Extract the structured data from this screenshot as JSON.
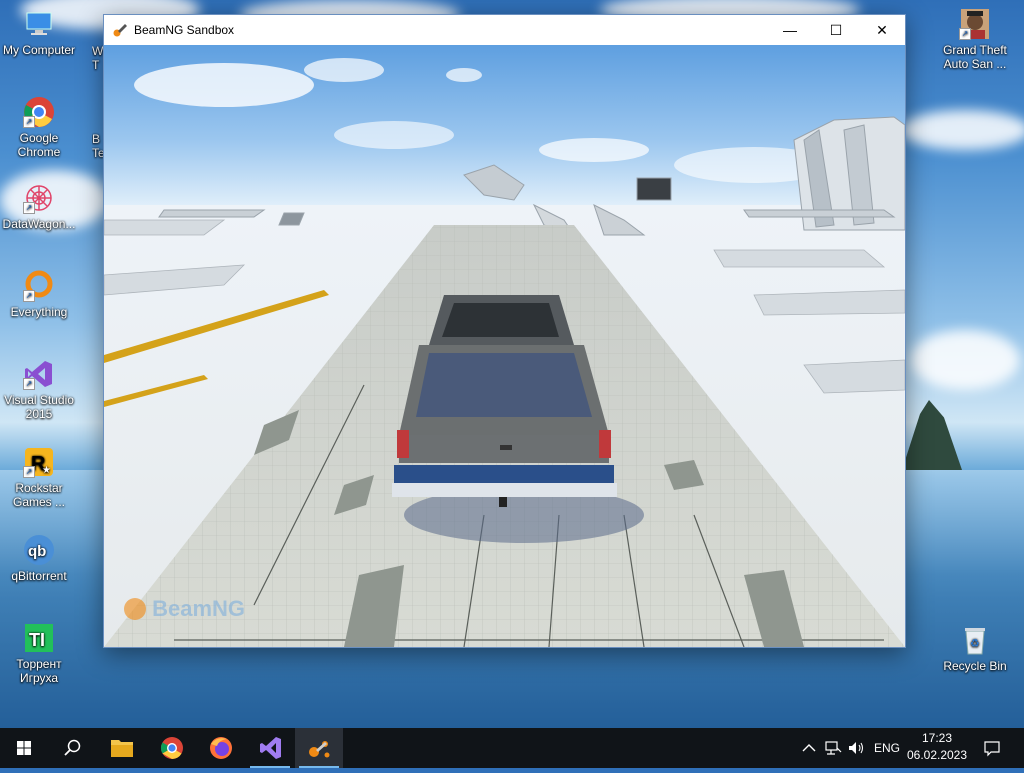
{
  "window": {
    "title": "BeamNG Sandbox",
    "minimize_glyph": "—",
    "maximize_glyph": "☐",
    "close_glyph": "✕",
    "watermark": "BeamNG"
  },
  "desktop_icons": [
    {
      "label": "My Computer",
      "icon": "computer-icon"
    },
    {
      "label": "Google Chrome",
      "icon": "chrome-icon"
    },
    {
      "label": "DataWagon...",
      "icon": "datawagon-icon"
    },
    {
      "label": "Everything",
      "icon": "everything-icon"
    },
    {
      "label": "Visual Studio 2015",
      "icon": "visual-studio-icon"
    },
    {
      "label": "Rockstar Games ...",
      "icon": "rockstar-icon"
    },
    {
      "label": "qBittorrent",
      "icon": "qbittorrent-icon"
    },
    {
      "label": "Торрент Игруха",
      "icon": "torrent-igruha-icon"
    },
    {
      "label": "Grand Theft Auto San ...",
      "icon": "gta-sa-icon"
    },
    {
      "label": "Recycle Bin",
      "icon": "recycle-bin-icon"
    }
  ],
  "partial_icons": [
    {
      "label": "W T"
    },
    {
      "label": "B Te"
    }
  ],
  "taskbar": {
    "items": [
      "start-icon",
      "search-icon",
      "file-explorer-icon",
      "chrome-icon",
      "firefox-icon",
      "visual-studio-icon",
      "beamng-icon"
    ],
    "tray": {
      "language": "ENG",
      "time": "17:23",
      "date": "06.02.2023"
    }
  },
  "colors": {
    "accent": "#76b9ed",
    "taskbar": "#101418",
    "window_border": "#6a8fbf"
  }
}
